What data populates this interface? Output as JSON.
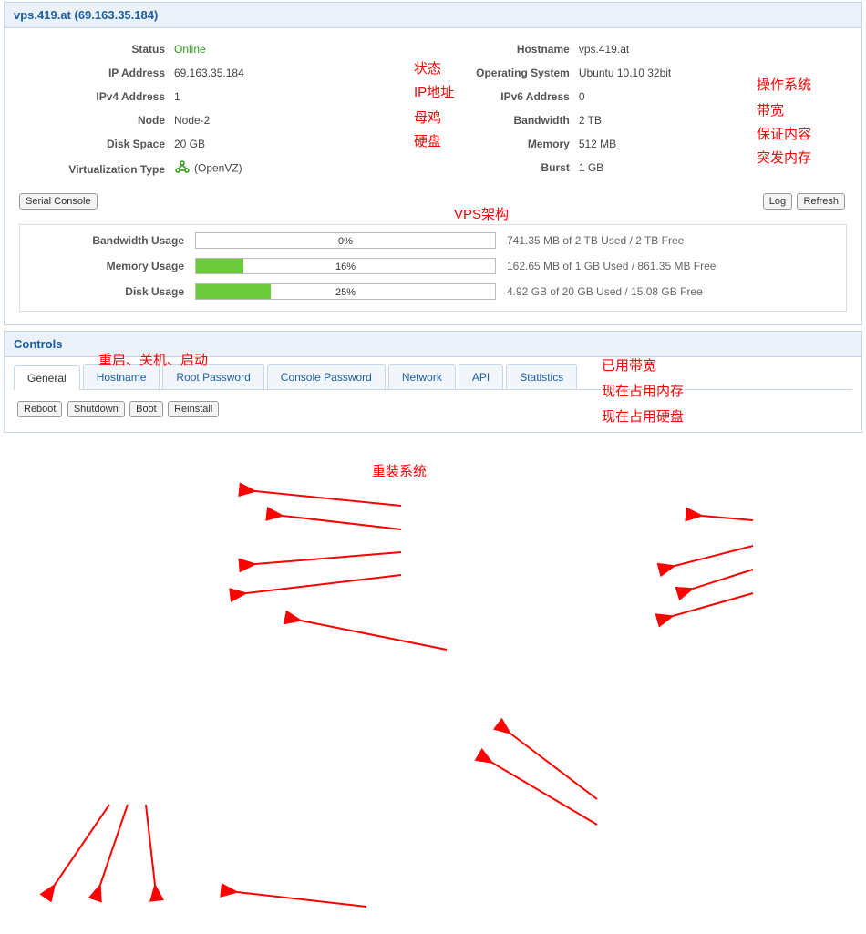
{
  "header_title": "vps.419.at (69.163.35.184)",
  "info_left": {
    "status_label": "Status",
    "status_value": "Online",
    "ip_label": "IP Address",
    "ip_value": "69.163.35.184",
    "ipv4_label": "IPv4 Address",
    "ipv4_value": "1",
    "node_label": "Node",
    "node_value": "Node-2",
    "disk_label": "Disk Space",
    "disk_value": "20 GB",
    "virt_label": "Virtualization Type",
    "virt_value": "(OpenVZ)"
  },
  "info_right": {
    "hostname_label": "Hostname",
    "hostname_value": "vps.419.at",
    "os_label": "Operating System",
    "os_value": "Ubuntu 10.10 32bit",
    "ipv6_label": "IPv6 Address",
    "ipv6_value": "0",
    "bw_label": "Bandwidth",
    "bw_value": "2 TB",
    "mem_label": "Memory",
    "mem_value": "512 MB",
    "burst_label": "Burst",
    "burst_value": "1 GB"
  },
  "buttons": {
    "serial": "Serial Console",
    "log": "Log",
    "refresh": "Refresh",
    "reboot": "Reboot",
    "shutdown": "Shutdown",
    "boot": "Boot",
    "reinstall": "Reinstall"
  },
  "usage": {
    "bw_label": "Bandwidth Usage",
    "bw_pct": "0%",
    "bw_detail": "741.35 MB of 2 TB Used / 2 TB Free",
    "mem_label": "Memory Usage",
    "mem_pct": "16%",
    "mem_detail": "162.65 MB of 1 GB Used / 861.35 MB Free",
    "disk_label": "Disk Usage",
    "disk_pct": "25%",
    "disk_detail": "4.92 GB of 20 GB Used / 15.08 GB Free"
  },
  "controls_title": "Controls",
  "tabs": {
    "general": "General",
    "hostname": "Hostname",
    "rootpw": "Root Password",
    "consolepw": "Console Password",
    "network": "Network",
    "api": "API",
    "stats": "Statistics"
  },
  "anno": {
    "status": "状态",
    "ip": "IP地址",
    "node": "母鸡",
    "disk": "硬盘",
    "arch": "VPS架构",
    "os": "操作系统",
    "bw": "带宽",
    "mem": "保证内容",
    "burst": "突发内存",
    "controls": "重启、关机、启动",
    "bw_used": "已用带宽",
    "mem_used": "现在占用内存",
    "disk_used": "现在占用硬盘",
    "reinstall": "重装系统"
  }
}
